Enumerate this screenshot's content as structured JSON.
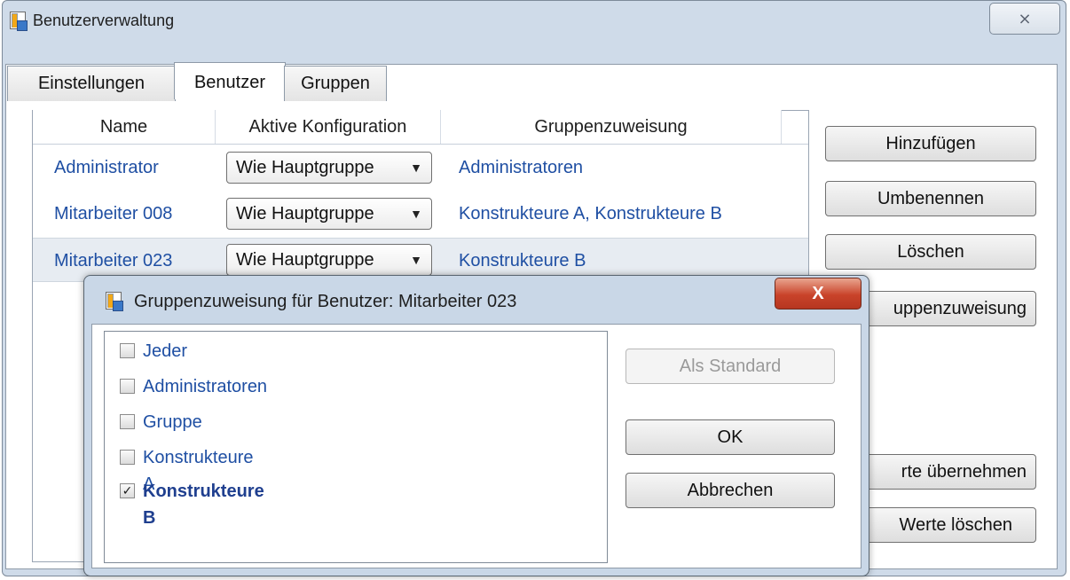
{
  "window": {
    "title": "Benutzerverwaltung",
    "close_glyph": "⨯"
  },
  "tabs": [
    {
      "label": "Einstellungen",
      "active": false
    },
    {
      "label": "Benutzer",
      "active": true
    },
    {
      "label": "Gruppen",
      "active": false
    }
  ],
  "table": {
    "columns": [
      "Name",
      "Aktive Konfiguration",
      "Gruppenzuweisung"
    ],
    "rows": [
      {
        "name": "Administrator",
        "config": "Wie Hauptgruppe",
        "groups": "Administratoren",
        "selected": false
      },
      {
        "name": "Mitarbeiter 008",
        "config": "Wie Hauptgruppe",
        "groups": "Konstrukteure A, Konstrukteure B",
        "selected": false
      },
      {
        "name": "Mitarbeiter 023",
        "config": "Wie Hauptgruppe",
        "groups": "Konstrukteure B",
        "selected": true
      }
    ],
    "dropdown_glyph": "▼"
  },
  "side_buttons": {
    "add": "Hinzufügen",
    "rename": "Umbenennen",
    "delete": "Löschen",
    "group_assign": "uppenzuweisung",
    "apply_values": "rte übernehmen",
    "clear_values": "Werte löschen"
  },
  "dialog": {
    "title": "Gruppenzuweisung für Benutzer: Mitarbeiter 023",
    "close_glyph": "X",
    "groups": [
      {
        "label": "Jeder",
        "checked": false
      },
      {
        "label": "Administratoren",
        "checked": false
      },
      {
        "label": "Gruppe",
        "checked": false
      },
      {
        "label": "Konstrukteure A",
        "checked": false
      },
      {
        "label": "Konstrukteure B",
        "checked": true
      }
    ],
    "buttons": {
      "default": "Als Standard",
      "ok": "OK",
      "cancel": "Abbrechen"
    },
    "default_disabled": true
  },
  "colors": {
    "link_blue": "#1f4fa3",
    "frame": "#cfdbe9",
    "close_red": "#c9432a"
  }
}
